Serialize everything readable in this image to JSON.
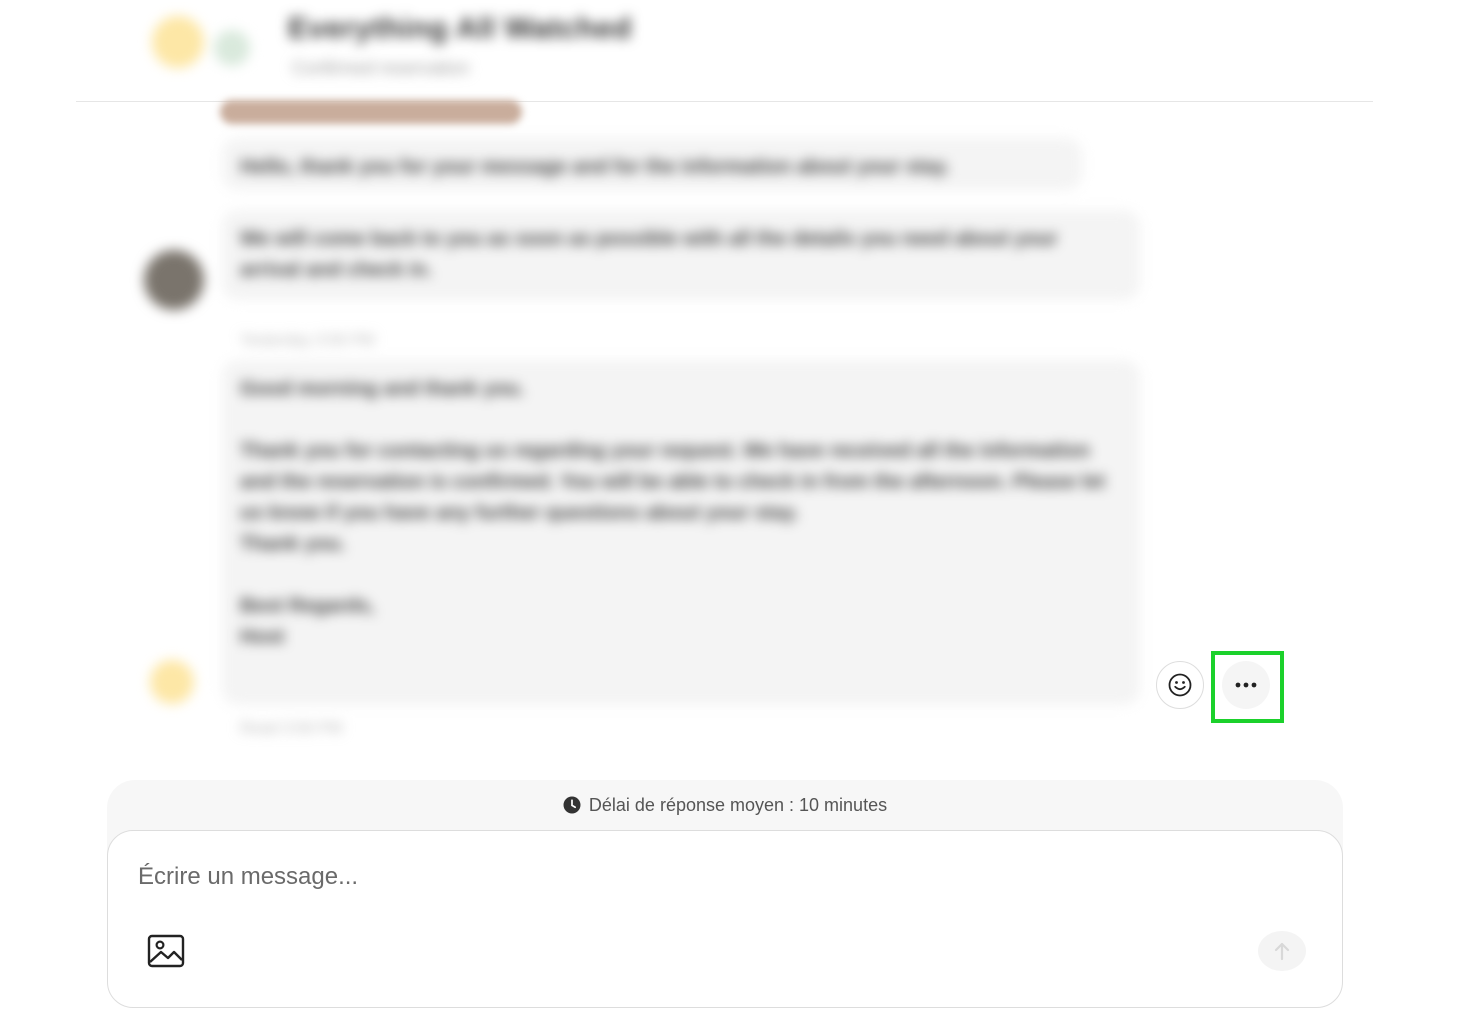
{
  "conversation": {
    "header": {
      "title": "Everything All Watched",
      "subtitle": "Confirmed reservation"
    },
    "messages": [
      {
        "text": "Hello, thank you for your message and for the information about your stay."
      },
      {
        "text": "We will come back to you as soon as possible with all the details you need about your arrival and check in."
      },
      {
        "text": "Good morning and thank you.\n\nThank you for contacting us regarding your request. We have received all the information and the reservation is confirmed. You will be able to check in from the afternoon. Please let us know if you have any further questions about your stay.\nThank you.\n\nBest Regards,\nHost"
      }
    ],
    "timestamp": "Yesterday 3:56 PM",
    "read_status": "Read 3:56 PM"
  },
  "message_actions": {
    "emoji_icon": "smiley-face-icon",
    "more_icon": "ellipsis-icon",
    "highlight_color": "#1bd12b"
  },
  "composer": {
    "response_time": "Délai de réponse moyen : 10 minutes",
    "placeholder": "Écrire un message...",
    "image_icon": "image-icon",
    "send_icon": "arrow-up-icon"
  }
}
